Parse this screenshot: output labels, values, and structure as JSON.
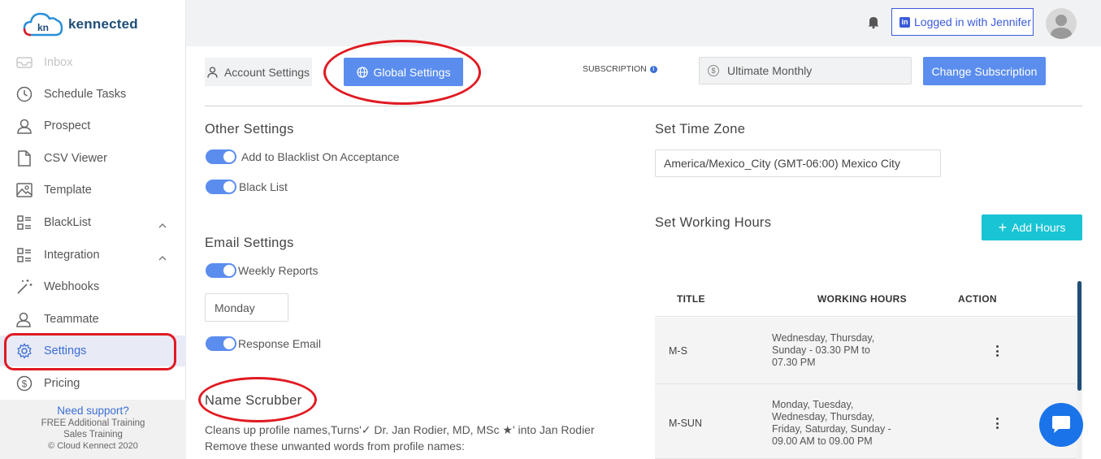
{
  "brand": {
    "logo_badge": "kn",
    "name": "kennected"
  },
  "sidebar": {
    "items": [
      {
        "label": "Inbox",
        "icon": "inbox-icon"
      },
      {
        "label": "Schedule Tasks",
        "icon": "clock-icon"
      },
      {
        "label": "Prospect",
        "icon": "user-icon"
      },
      {
        "label": "CSV Viewer",
        "icon": "file-icon"
      },
      {
        "label": "Template",
        "icon": "image-icon"
      },
      {
        "label": "BlackList",
        "icon": "list-icon"
      },
      {
        "label": "Integration",
        "icon": "list-icon"
      },
      {
        "label": "Webhooks",
        "icon": "magic-wand-icon"
      },
      {
        "label": "Teammate",
        "icon": "users-icon"
      },
      {
        "label": "Settings",
        "icon": "gear-icon",
        "active": true
      },
      {
        "label": "Pricing",
        "icon": "dollar-icon"
      }
    ],
    "footer": {
      "support": "Need support?",
      "training": "FREE Additional Training",
      "sales": "Sales Training",
      "copyright": "© Cloud Kennect 2020"
    }
  },
  "topbar": {
    "linkedin_label": "Logged in with Jennifer",
    "linkedin_badge": "in"
  },
  "tabs": {
    "account": "Account Settings",
    "global": "Global Settings"
  },
  "subscription": {
    "label": "SUBSCRIPTION",
    "info_badge": "i",
    "dollar_badge": "$",
    "value": "Ultimate Monthly",
    "change_button": "Change Subscription"
  },
  "other_settings": {
    "title": "Other Settings",
    "add_blacklist": "Add to Blacklist On Acceptance",
    "black_list": "Black List"
  },
  "email_settings": {
    "title": "Email Settings",
    "weekly_reports": "Weekly Reports",
    "day": "Monday",
    "response_email": "Response Email"
  },
  "name_scrubber": {
    "title": "Name Scrubber",
    "description": "Cleans up profile names,Turns'✓ Dr. Jan Rodier, MD, MSc ★' into Jan Rodier Remove these unwanted words from profile names:"
  },
  "time_zone": {
    "title": "Set Time Zone",
    "value": "America/Mexico_City (GMT-06:00) Mexico City"
  },
  "working_hours": {
    "title": "Set Working Hours",
    "add_button": "Add Hours",
    "add_plus": "+",
    "columns": {
      "title": "TITLE",
      "hours": "WORKING HOURS",
      "action": "ACTION"
    },
    "rows": [
      {
        "title": "M-S",
        "hours": "Wednesday, Thursday, Sunday - 03.30 PM to 07.30 PM"
      },
      {
        "title": "M-SUN",
        "hours": "Monday, Tuesday, Wednesday, Thursday, Friday, Saturday, Sunday - 09.00 AM to 09.00 PM"
      }
    ]
  },
  "colors": {
    "primary": "#5b8def",
    "accent_cyan": "#19c4d5",
    "annotation_red": "#e01a22",
    "brand_navy": "#1f4e79",
    "chat_blue": "#1a73e8"
  }
}
